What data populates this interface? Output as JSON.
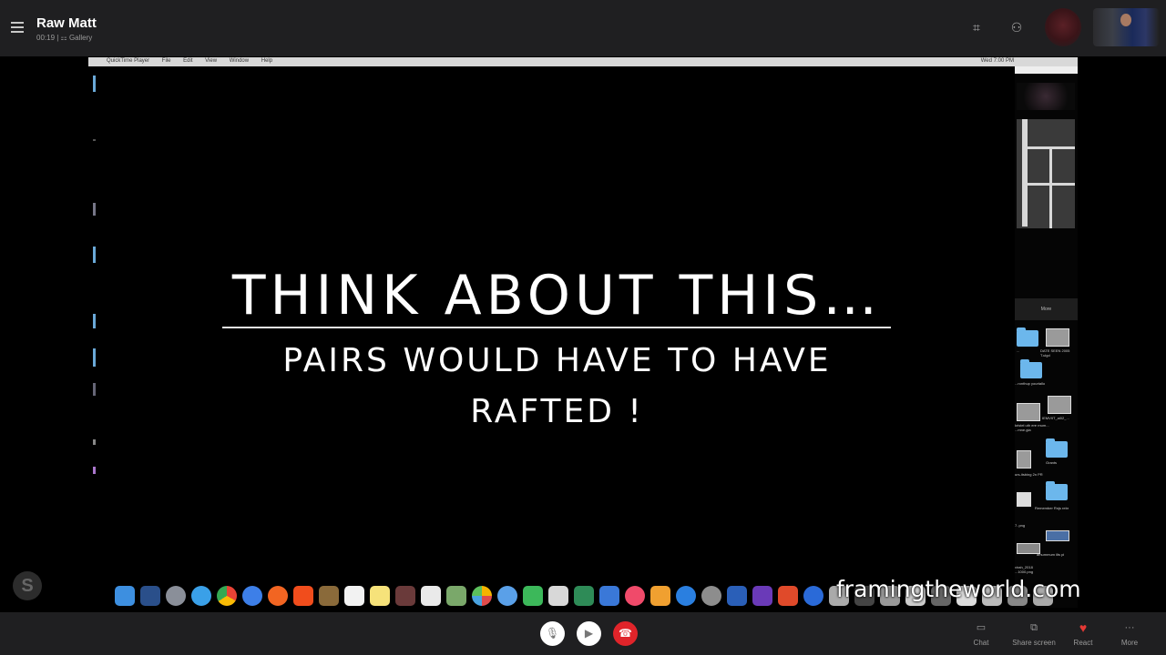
{
  "meeting": {
    "title": "Raw Matt",
    "subtitle": "00:19 | ⚏ Gallery"
  },
  "share": {
    "menu": [
      "QuickTime Player",
      "File",
      "Edit",
      "View",
      "Window",
      "Help"
    ],
    "status": "Wed 7:00 PM"
  },
  "slide": {
    "title": "THINK ABOUT THIS…",
    "line1": "PAIRS WOULD HAVE TO HAVE",
    "line2": "RAFTED !"
  },
  "right_panel": {
    "more_label": "More",
    "files": [
      "...",
      "DATE SEEN 2005 T.ulgd",
      "...ronthup yourtallo",
      "IEMVIIT_ai02_...",
      "kristel uth ere rnum... ...mne.gia",
      "Grants",
      "urs-itsbing 2n PR",
      "Remember Rnjs rebr",
      "7..png",
      "amummum ilts pi",
      "virah_2018 ...1000.png"
    ]
  },
  "watermark": "framingtheworld.com",
  "badge": "S",
  "controls": {
    "mic": "🎙",
    "camera": "▶",
    "hangup": "☎"
  },
  "bottom": {
    "chat": "Chat",
    "share_screen": "Share screen",
    "react": "React",
    "more": "More",
    "more_glyph": "···"
  },
  "colors": {
    "hangup": "#e0242a",
    "bar": "#1f1f21",
    "folder": "#6cb7ec"
  }
}
